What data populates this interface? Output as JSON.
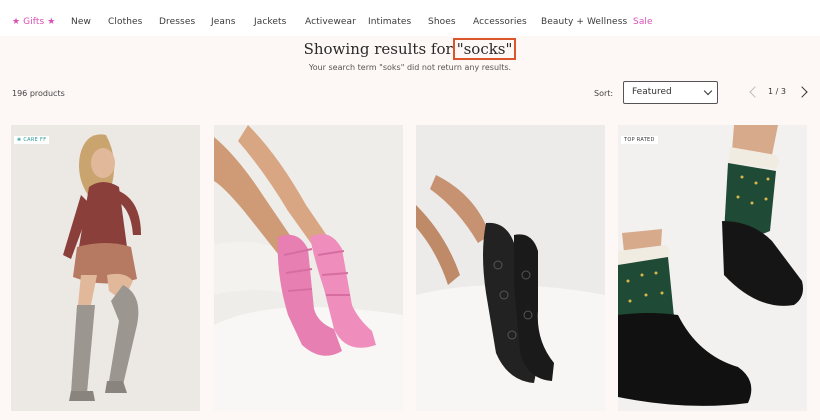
{
  "nav": {
    "items": [
      {
        "label": "★ Gifts ★",
        "accent": true
      },
      {
        "label": "New"
      },
      {
        "label": "Clothes"
      },
      {
        "label": "Dresses"
      },
      {
        "label": "Jeans"
      },
      {
        "label": "Jackets"
      },
      {
        "label": "Activewear"
      },
      {
        "label": "Intimates"
      },
      {
        "label": "Shoes"
      },
      {
        "label": "Accessories"
      },
      {
        "label": "Beauty + Wellness"
      },
      {
        "label": "Sale",
        "accent": true
      }
    ]
  },
  "results": {
    "heading_prefix": "Showing results for",
    "search_term": "\"socks\"",
    "notice": "Your search term \"soks\" did not return any results.",
    "count": "196 products"
  },
  "sort": {
    "label": "Sort:",
    "selected": "Featured"
  },
  "pagination": {
    "text": "1 / 3"
  },
  "products": [
    {
      "badge": "CARE FF",
      "badge_icon": "leaf-icon"
    },
    {
      "badge": ""
    },
    {
      "badge": ""
    },
    {
      "badge": "TOP RATED"
    }
  ],
  "colors": {
    "accent_pink": "#d94fb6",
    "highlight_border": "#d9552c",
    "page_background": "#fdf8f6"
  }
}
